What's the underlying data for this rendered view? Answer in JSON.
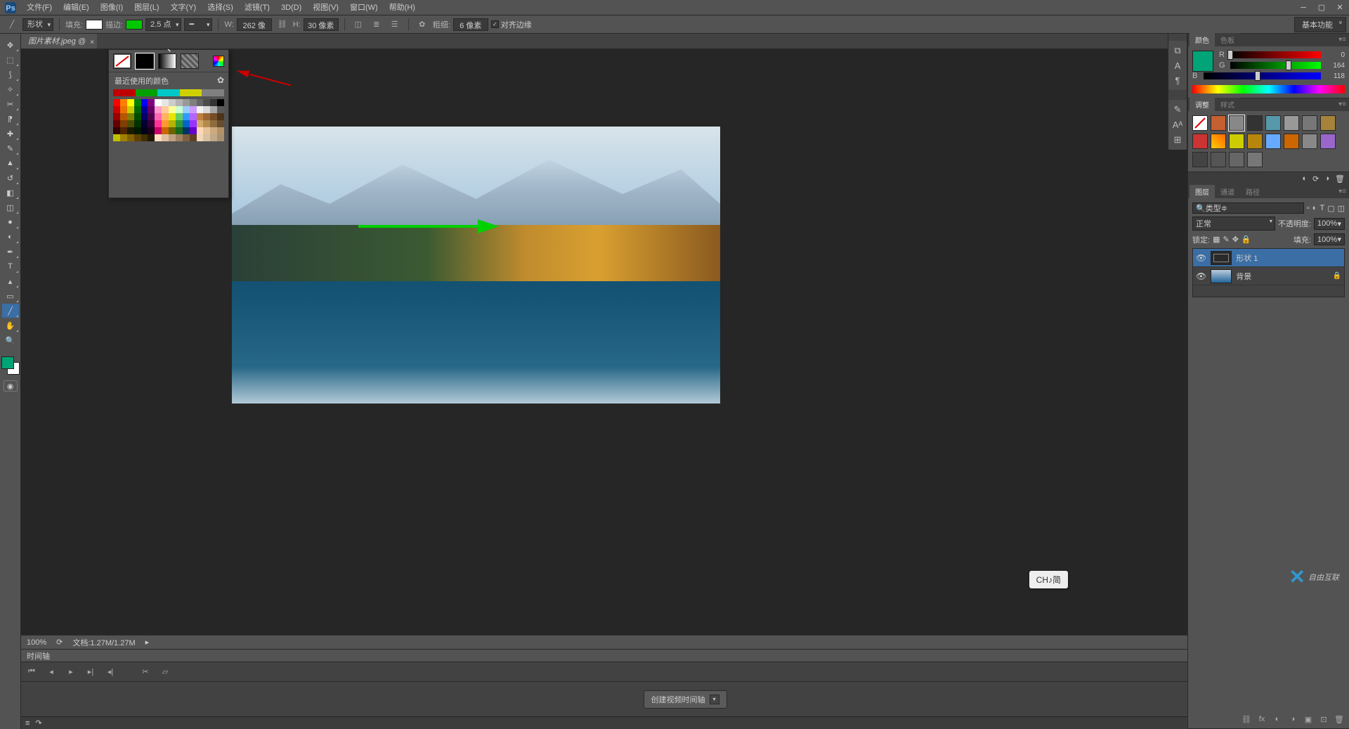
{
  "menubar": {
    "items": [
      "文件(F)",
      "编辑(E)",
      "图像(I)",
      "图层(L)",
      "文字(Y)",
      "选择(S)",
      "滤镜(T)",
      "3D(D)",
      "视图(V)",
      "窗口(W)",
      "帮助(H)"
    ]
  },
  "options": {
    "tool_mode": "形状",
    "fill_label": "填充:",
    "fill_color": "#ffffff",
    "stroke_label": "描边:",
    "stroke_color": "#00c800",
    "stroke_width": "2.5 点",
    "w_label": "W:",
    "w_value": "262 像",
    "link_icon": "⛓",
    "h_label": "H:",
    "h_value": "30 像素",
    "thick_label": "粗细:",
    "thick_value": "6 像素",
    "align_edges": "对齐边缘",
    "workspace": "基本功能"
  },
  "document": {
    "tab": "图片素材.jpeg @"
  },
  "statusbar": {
    "zoom": "100%",
    "docinfo": "文档:1.27M/1.27M"
  },
  "timeline": {
    "tab": "时间轴",
    "create": "创建视频时间轴"
  },
  "color_popup": {
    "recent_label": "最近使用的颜色",
    "recent": [
      "#c00000",
      "#00a000",
      "#00c8c8",
      "#d0d000",
      "#808080"
    ],
    "rows": [
      [
        "#ff0000",
        "#ff8000",
        "#ffff00",
        "#008000",
        "#0000ff",
        "#800080",
        "#ffffff",
        "#e6e6e6",
        "#cccccc",
        "#b3b3b3",
        "#999999",
        "#808080",
        "#666666",
        "#4d4d4d",
        "#333333",
        "#000000"
      ],
      [
        "#cc0000",
        "#e67300",
        "#cccc00",
        "#006600",
        "#000099",
        "#660066",
        "#ff99cc",
        "#ffcc99",
        "#ffff99",
        "#ccffcc",
        "#99ccff",
        "#cc99ff",
        "#f2f2f2",
        "#d9d9d9",
        "#a6a6a6",
        "#595959"
      ],
      [
        "#990000",
        "#b35900",
        "#808000",
        "#004d00",
        "#000066",
        "#4d004d",
        "#ff66b3",
        "#ffb366",
        "#e6e600",
        "#66cc66",
        "#3399ff",
        "#b366ff",
        "#bf8040",
        "#996633",
        "#734d26",
        "#4d3319"
      ],
      [
        "#660000",
        "#804000",
        "#4d4d00",
        "#003300",
        "#000033",
        "#330033",
        "#ff3399",
        "#ff9933",
        "#b3b300",
        "#339933",
        "#0066cc",
        "#9933ff",
        "#d4a76a",
        "#b38b4d",
        "#8c6b3d",
        "#664d2e"
      ],
      [
        "#330000",
        "#4d2600",
        "#1a1a00",
        "#001a00",
        "#00001a",
        "#1a001a",
        "#cc0066",
        "#cc6600",
        "#666600",
        "#1a661a",
        "#003366",
        "#6600cc",
        "#ffd9b3",
        "#e6c299",
        "#ccaa80",
        "#b39266"
      ],
      [
        "#c0c000",
        "#a08000",
        "#806000",
        "#604000",
        "#403000",
        "#201800",
        "#ffe0c0",
        "#e0c0a0",
        "#c0a080",
        "#a08060",
        "#806040",
        "#604020",
        "#f0d8b8",
        "#d8c0a0",
        "#c0a888",
        "#a89070"
      ]
    ]
  },
  "panels": {
    "color": {
      "tabs": [
        "颜色",
        "色板"
      ],
      "r": {
        "label": "R",
        "value": 0,
        "pos": 0
      },
      "g": {
        "label": "G",
        "value": 164,
        "pos": 64
      },
      "b": {
        "label": "B",
        "value": 118,
        "pos": 46
      },
      "swatch": "#00a476"
    },
    "adjust": {
      "tabs": [
        "调整",
        "样式"
      ]
    },
    "layers": {
      "tabs": [
        "图层",
        "通道",
        "路径"
      ],
      "filter": "类型",
      "blend": "正常",
      "opacity_label": "不透明度:",
      "opacity": "100%",
      "lock_label": "锁定:",
      "fill_label": "填充:",
      "fill": "100%",
      "items": [
        {
          "name": "形状 1",
          "thumb": "#2a2a2a",
          "selected": true,
          "lock": false
        },
        {
          "name": "背景",
          "thumb": "linear-gradient(180deg,#bcd 0%,#269 100%)",
          "selected": false,
          "lock": true
        }
      ]
    }
  },
  "ime": "CH♪简",
  "watermark": "自由互联"
}
